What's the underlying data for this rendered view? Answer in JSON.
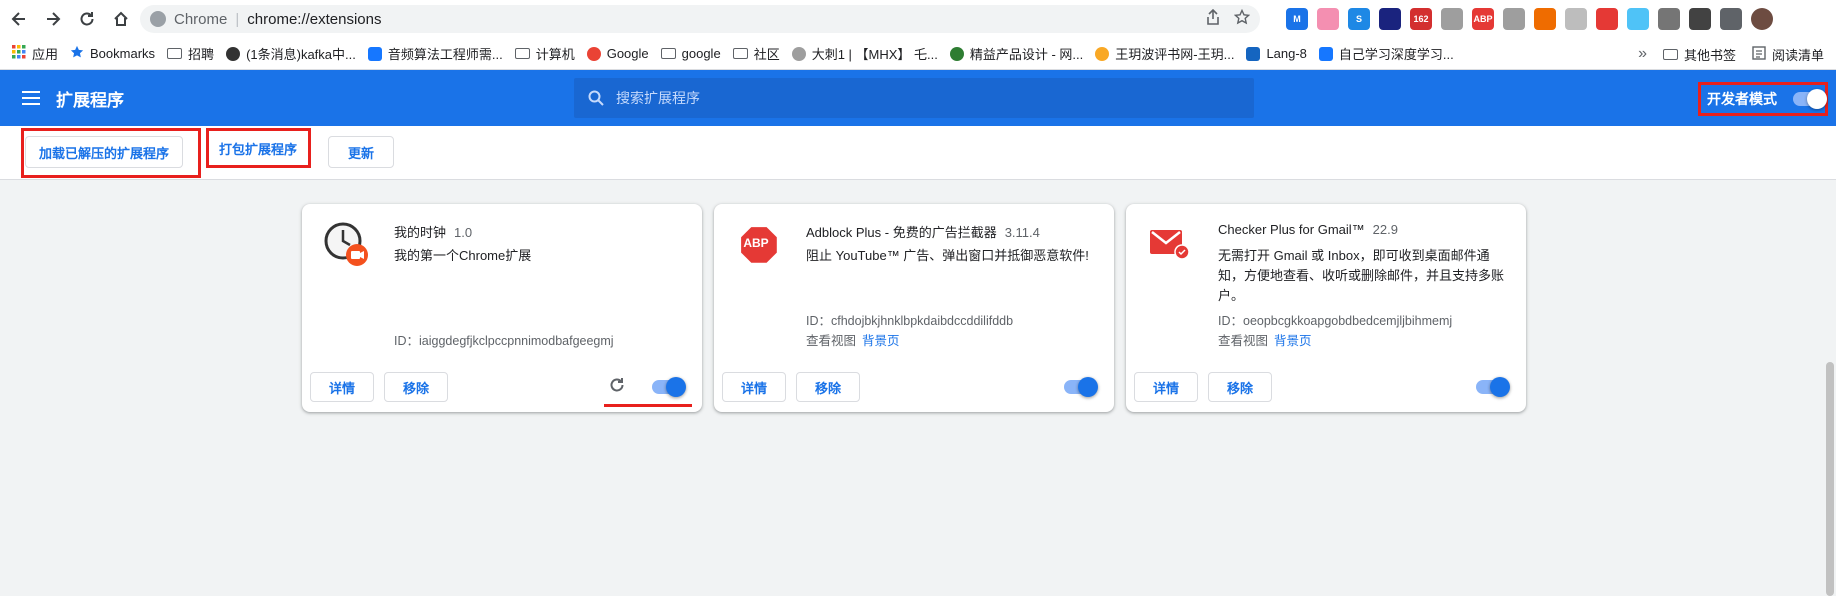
{
  "browser": {
    "scheme_label": "Chrome",
    "url": "chrome://extensions",
    "extension_icons": [
      {
        "name": "m-extension-icon",
        "text": "M",
        "color": "#1a73e8"
      },
      {
        "name": "cat-extension-icon",
        "text": "",
        "color": "#f48fb1"
      },
      {
        "name": "s-extension-icon",
        "text": "S",
        "color": "#1e88e5"
      },
      {
        "name": "hat-extension-icon",
        "text": "",
        "color": "#1a237e"
      },
      {
        "name": "mail-162-extension-icon",
        "text": "162",
        "color": "#d32f2f"
      },
      {
        "name": "grid-extension-icon",
        "text": "",
        "color": "#9e9e9e"
      },
      {
        "name": "abp-extension-icon",
        "text": "ABP",
        "color": "#e53935"
      },
      {
        "name": "chart-extension-icon",
        "text": "",
        "color": "#9e9e9e"
      },
      {
        "name": "fox-extension-icon",
        "text": "",
        "color": "#ef6c00"
      },
      {
        "name": "circle-extension-icon",
        "text": "",
        "color": "#bdbdbd"
      },
      {
        "name": "rocket-extension-icon",
        "text": "",
        "color": "#e53935"
      },
      {
        "name": "ring-extension-icon",
        "text": "",
        "color": "#4fc3f7"
      },
      {
        "name": "v-extension-icon",
        "text": "",
        "color": "#757575"
      },
      {
        "name": "clock-extension-icon",
        "text": "",
        "color": "#424242"
      },
      {
        "name": "puzzle-extension-icon",
        "text": "",
        "color": "#5f6368"
      },
      {
        "name": "profile-avatar",
        "text": "",
        "color": "#6d4c41"
      }
    ]
  },
  "bookmarks": {
    "items": [
      {
        "label": "应用",
        "icon": "apps-grid-icon"
      },
      {
        "label": "Bookmarks",
        "icon": "star-icon"
      },
      {
        "label": "招聘",
        "icon": "folder-icon"
      },
      {
        "label": "(1条消息)kafka中...",
        "icon": "site-icon"
      },
      {
        "label": "音频算法工程师需...",
        "icon": "zhihu-icon"
      },
      {
        "label": "计算机",
        "icon": "folder-icon"
      },
      {
        "label": "Google",
        "icon": "google-icon"
      },
      {
        "label": "google",
        "icon": "folder-icon"
      },
      {
        "label": "社区",
        "icon": "folder-icon"
      },
      {
        "label": "大刺1 | 【MHX】 乇...",
        "icon": "balloon-icon"
      },
      {
        "label": "精益产品设计 - 网...",
        "icon": "book-icon"
      },
      {
        "label": "王玥波评书网-王玥...",
        "icon": "face-icon"
      },
      {
        "label": "Lang-8",
        "icon": "check-icon"
      },
      {
        "label": "自己学习深度学习...",
        "icon": "zhihu-icon"
      }
    ],
    "overflow": "»",
    "other_folder": "其他书签",
    "reading_list": "阅读清单"
  },
  "header": {
    "title": "扩展程序",
    "search_placeholder": "搜索扩展程序",
    "dev_mode_label": "开发者模式",
    "dev_mode_on": true
  },
  "toolbar": {
    "load_unpacked": "加载已解压的扩展程序",
    "pack": "打包扩展程序",
    "update": "更新"
  },
  "extensions": [
    {
      "name": "我的时钟",
      "version": "1.0",
      "description": "我的第一个Chrome扩展",
      "id_label": "ID：iaiggdegfjkclpccpnnimodbafgeegmj",
      "views_label": "",
      "views_link": "",
      "details": "详情",
      "remove": "移除",
      "enabled": true,
      "logo": "clock-logo-icon"
    },
    {
      "name": "Adblock Plus - 免费的广告拦截器",
      "version": "3.11.4",
      "description": "阻止 YouTube™ 广告、弹出窗口并抵御恶意软件!",
      "id_label": "ID：cfhdojbkjhnklbpkdaibdccddilifddb",
      "views_label": "查看视图",
      "views_link": "背景页",
      "details": "详情",
      "remove": "移除",
      "enabled": true,
      "logo": "abp-logo-icon"
    },
    {
      "name": "Checker Plus for Gmail™",
      "version": "22.9",
      "description": "无需打开 Gmail 或 Inbox，即可收到桌面邮件通知，方便地查看、收听或删除邮件，并且支持多账户。",
      "id_label": "ID：oeopbcgkkoapgobdbedcemjljbihmemj",
      "views_label": "查看视图",
      "views_link": "背景页",
      "details": "详情",
      "remove": "移除",
      "enabled": true,
      "logo": "mail-logo-icon"
    }
  ],
  "colors": {
    "accent": "#1a73e8",
    "highlight": "#e8201d"
  }
}
